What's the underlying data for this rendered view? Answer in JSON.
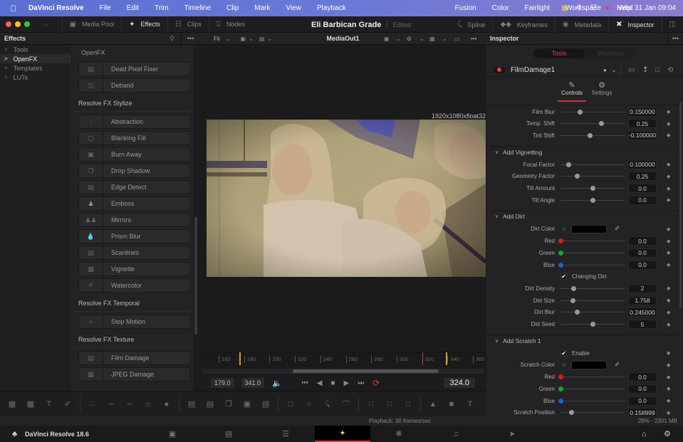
{
  "menubar": {
    "app_name": "DaVinci Resolve",
    "items": [
      "File",
      "Edit",
      "Trim",
      "Timeline",
      "Clip",
      "Mark",
      "View",
      "Playback",
      "Fusion",
      "Color",
      "Fairlight",
      "Workspace",
      "Help"
    ],
    "datetime": "Wed 31 Jan  09:04"
  },
  "toolbar": {
    "media_pool": "Media Pool",
    "effects": "Effects",
    "clips": "Clips",
    "nodes": "Nodes",
    "project_title": "Eli Barbican Grade",
    "project_status": "Edited",
    "spline": "Spline",
    "keyframes": "Keyframes",
    "metadata": "Metadata",
    "inspector": "Inspector"
  },
  "effects_panel": {
    "title": "Effects",
    "tree": [
      {
        "label": "Tools",
        "selected": false
      },
      {
        "label": "OpenFX",
        "selected": true
      },
      {
        "label": "Templates",
        "selected": false
      },
      {
        "label": "LUTs",
        "selected": false
      }
    ],
    "categories": [
      {
        "name": "OpenFX",
        "items": [
          "Dead Pixel Fixer",
          "Deband"
        ]
      },
      {
        "name": "Resolve FX Stylize",
        "items": [
          "Abstraction",
          "Blanking Fill",
          "Burn Away",
          "Drop Shadow",
          "Edge Detect",
          "Emboss",
          "Mirrors",
          "Prism Blur",
          "Scanlines",
          "Vignette",
          "Watercolor"
        ]
      },
      {
        "name": "Resolve FX Temporal",
        "items": [
          "Stop Motion"
        ]
      },
      {
        "name": "Resolve FX Texture",
        "items": [
          "Film Damage",
          "JPEG Damage"
        ]
      }
    ]
  },
  "viewer": {
    "zoom": "Fit",
    "title": "MediaOut1",
    "resolution": "1920x1080xfloat32",
    "ruler_ticks": [
      "160",
      "180",
      "200",
      "220",
      "240",
      "260",
      "280",
      "300",
      "320",
      "340",
      "360"
    ],
    "in_point": "179.0",
    "out_point": "341.0",
    "current_frame": "324.0"
  },
  "inspector": {
    "title": "Inspector",
    "tabs": [
      "Tools",
      "Modifiers"
    ],
    "node_name": "FilmDamage1",
    "subtabs": [
      "Controls",
      "Settings"
    ],
    "top_params": [
      {
        "label": "Film Blur",
        "value": "0.150000",
        "pos": 0.3
      },
      {
        "label": "Temp. Shift",
        "value": "0.25",
        "pos": 0.63
      },
      {
        "label": "Tint Shift",
        "value": "-0.100000",
        "pos": 0.45
      }
    ],
    "vignetting": {
      "title": "Add Vignetting",
      "params": [
        {
          "label": "Focal Factor",
          "value": "0.100000",
          "pos": 0.12
        },
        {
          "label": "Geometry Factor",
          "value": "0.25",
          "pos": 0.26
        },
        {
          "label": "Tilt Amount",
          "value": "0.0",
          "pos": 0.5
        },
        {
          "label": "Tilt Angle",
          "value": "0.0",
          "pos": 0.5
        }
      ]
    },
    "dirt": {
      "title": "Add Dirt",
      "color_label": "Dirt Color",
      "red": {
        "label": "Red",
        "value": "0.0"
      },
      "green": {
        "label": "Green",
        "value": "0.0"
      },
      "blue": {
        "label": "Blue",
        "value": "0.0"
      },
      "changing_label": "Changing Dirt",
      "params": [
        {
          "label": "Dirt Density",
          "value": "2",
          "pos": 0.2
        },
        {
          "label": "Dirt Size",
          "value": "1.758",
          "pos": 0.19
        },
        {
          "label": "Dirt Blur",
          "value": "0.245000",
          "pos": 0.25
        },
        {
          "label": "Dirt Seed",
          "value": "5",
          "pos": 0.5
        }
      ]
    },
    "scratch": {
      "title": "Add Scratch 1",
      "enable_label": "Enable",
      "color_label": "Scratch Color",
      "red": {
        "label": "Red",
        "value": "0.0"
      },
      "green": {
        "label": "Green",
        "value": "0.0"
      },
      "blue": {
        "label": "Blue",
        "value": "0.0"
      },
      "position": {
        "label": "Scratch Position",
        "value": "0.158999",
        "pos": 0.17
      }
    }
  },
  "status": {
    "playback": "Playback: 30 frames/sec",
    "memory": "28% - 2301 MB"
  },
  "footer": {
    "app_version": "DaVinci Resolve 18.6"
  },
  "colors": {
    "accent_red": "#d33a3a",
    "red_dot": "#d0201c",
    "green_dot": "#1fa030",
    "blue_dot": "#2060c0",
    "marker_yellow": "#d8a020"
  }
}
